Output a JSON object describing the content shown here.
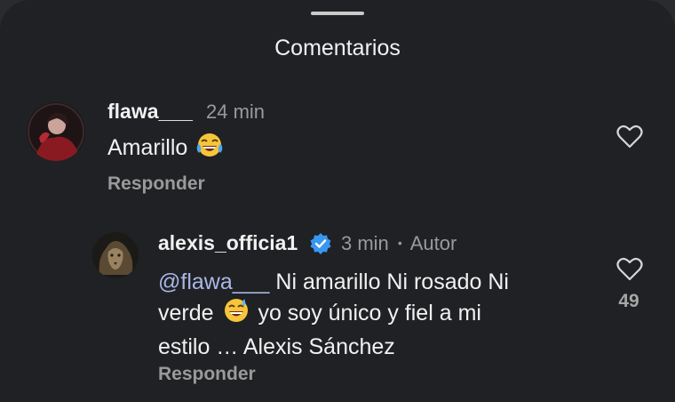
{
  "header": {
    "title": "Comentarios"
  },
  "comments": [
    {
      "username": "flawa___",
      "time": "24 min",
      "text": "Amarillo",
      "emoji": "😂",
      "reply_label": "Responder"
    },
    {
      "username": "alexis_officia1",
      "verified": true,
      "time": "3 min",
      "separator": "•",
      "author_label": "Autor",
      "mention": "@flawa___",
      "line1": "Ni amarillo Ni rosado Ni",
      "line2_before": "verde",
      "emoji": "😅",
      "line2_after": "yo soy único y  fiel a mi",
      "line3": "estilo … Alexis Sánchez",
      "reply_label": "Responder",
      "likes": "49"
    }
  ],
  "colors": {
    "background": "#202124",
    "text": "#f1f1f1",
    "muted": "#9a9a9a",
    "mention": "#a9b7e6",
    "verified": "#3897f0"
  }
}
